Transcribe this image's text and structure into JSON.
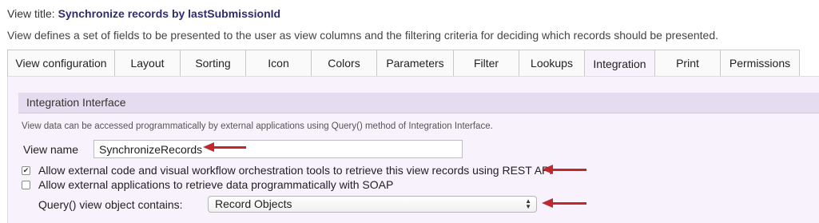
{
  "header": {
    "title_prefix": "View title:",
    "title_value": "Synchronize records by lastSubmissionId",
    "description": "View defines a set of fields to be presented to the user as view columns and the filtering criteria for deciding which records should be presented."
  },
  "tabs": [
    {
      "label": "View configuration"
    },
    {
      "label": "Layout"
    },
    {
      "label": "Sorting"
    },
    {
      "label": "Icon"
    },
    {
      "label": "Colors"
    },
    {
      "label": "Parameters"
    },
    {
      "label": "Filter"
    },
    {
      "label": "Lookups"
    },
    {
      "label": "Integration"
    },
    {
      "label": "Print"
    },
    {
      "label": "Permissions"
    }
  ],
  "active_tab": "Integration",
  "integration": {
    "section_title": "Integration Interface",
    "note": "View data can be accessed programmatically by external applications using Query() method of Integration Interface.",
    "view_name_label": "View name",
    "view_name_value": "SynchronizeRecords",
    "rest_label": "Allow external code and visual workflow orchestration tools to retrieve this view records using REST API",
    "rest_checked": true,
    "soap_label": "Allow external applications to retrieve data programmatically with SOAP",
    "soap_checked": false,
    "query_label": "Query() view object contains:",
    "query_selected": "Record Objects"
  },
  "colors": {
    "title_accent": "#2f2c6e",
    "panel_bg": "#f7f2fb",
    "section_header_bg": "#e6dcf0",
    "annotation_arrow": "#c0282d"
  }
}
